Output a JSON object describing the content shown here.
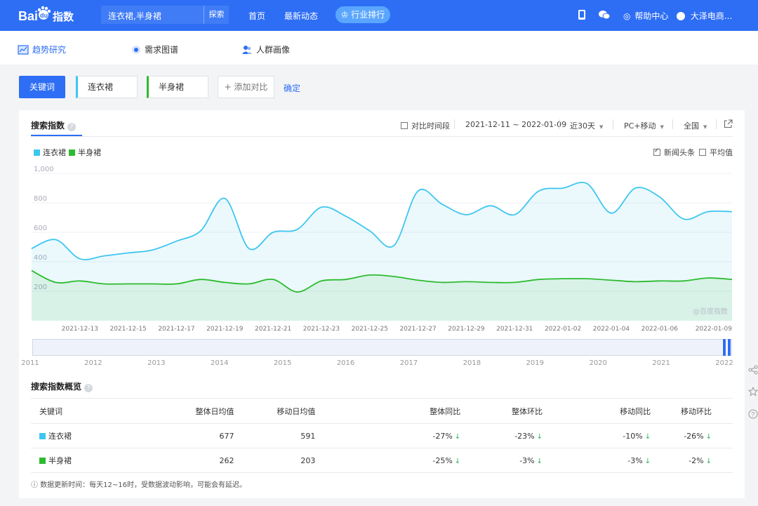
{
  "topbar": {
    "logo_text": "Bai du 指数",
    "search_value": "连衣裙,半身裙",
    "search_button": "探索",
    "nav": [
      "首页",
      "最新动态"
    ],
    "rank_button": "行业排行",
    "help": "帮助中心",
    "user": "大泽电商..."
  },
  "subnav": {
    "tabs": [
      "趋势研究",
      "需求图谱",
      "人群画像"
    ]
  },
  "keywords": {
    "button": "关键词",
    "items": [
      {
        "label": "连衣裙",
        "color": "#3ec6f0"
      },
      {
        "label": "半身裙",
        "color": "#2dbb2d"
      }
    ],
    "add": "+ 添加对比",
    "confirm": "确定"
  },
  "search_index": {
    "title": "搜索指数",
    "help_mark": "?",
    "compare_period": "对比时间段",
    "date_range": "2021-12-11 ~ 2022-01-09",
    "period": "近30天",
    "device": "PC+移动",
    "region": "全国",
    "news_label": "新闻头条",
    "news_checked": true,
    "avg_label": "平均值",
    "avg_checked": false,
    "watermark": "@百度指数"
  },
  "chart_data": {
    "type": "area",
    "x": [
      "2021-12-11",
      "2021-12-12",
      "2021-12-13",
      "2021-12-14",
      "2021-12-15",
      "2021-12-16",
      "2021-12-17",
      "2021-12-18",
      "2021-12-19",
      "2021-12-20",
      "2021-12-21",
      "2021-12-22",
      "2021-12-23",
      "2021-12-24",
      "2021-12-25",
      "2021-12-26",
      "2021-12-27",
      "2021-12-28",
      "2021-12-29",
      "2021-12-30",
      "2021-12-31",
      "2022-01-01",
      "2022-01-02",
      "2022-01-03",
      "2022-01-04",
      "2022-01-05",
      "2022-01-06",
      "2022-01-07",
      "2022-01-08",
      "2022-01-09"
    ],
    "xtick_labels": [
      "2021-12-13",
      "2021-12-15",
      "2021-12-17",
      "2021-12-19",
      "2021-12-21",
      "2021-12-23",
      "2021-12-25",
      "2021-12-27",
      "2021-12-29",
      "2021-12-31",
      "2022-01-02",
      "2022-01-04",
      "2022-01-06",
      "2022-01-09"
    ],
    "ytick_labels": [
      "1,000",
      "800",
      "600",
      "400",
      "200"
    ],
    "ylim": [
      0,
      1000
    ],
    "series": [
      {
        "name": "连衣裙",
        "color": "#3ec6f0",
        "values": [
          490,
          550,
          420,
          440,
          460,
          480,
          540,
          610,
          830,
          490,
          600,
          620,
          770,
          710,
          610,
          510,
          880,
          790,
          720,
          780,
          720,
          880,
          900,
          930,
          730,
          900,
          840,
          690,
          740,
          740
        ]
      },
      {
        "name": "半身裙",
        "color": "#2dbb2d",
        "values": [
          340,
          260,
          270,
          250,
          250,
          250,
          250,
          280,
          260,
          250,
          280,
          195,
          270,
          280,
          310,
          300,
          275,
          260,
          265,
          260,
          260,
          280,
          285,
          285,
          275,
          265,
          270,
          270,
          290,
          280
        ]
      }
    ]
  },
  "timeline": {
    "years": [
      "2011",
      "2012",
      "2013",
      "2014",
      "2015",
      "2016",
      "2017",
      "2018",
      "2019",
      "2020",
      "2021",
      "2022"
    ]
  },
  "overview": {
    "title": "搜索指数概览",
    "headers": [
      "关键词",
      "整体日均值",
      "移动日均值",
      "整体同比",
      "整体环比",
      "移动同比",
      "移动环比"
    ],
    "rows": [
      {
        "keyword": "连衣裙",
        "color": "#3ec6f0",
        "cells": [
          "677",
          "591",
          "-27%",
          "-23%",
          "-10%",
          "-26%"
        ]
      },
      {
        "keyword": "半身裙",
        "color": "#2dbb2d",
        "cells": [
          "262",
          "203",
          "-25%",
          "-3%",
          "-3%",
          "-2%"
        ]
      }
    ],
    "note": "数据更新时间：每天12~16时，受数据波动影响，可能会有延迟。"
  }
}
